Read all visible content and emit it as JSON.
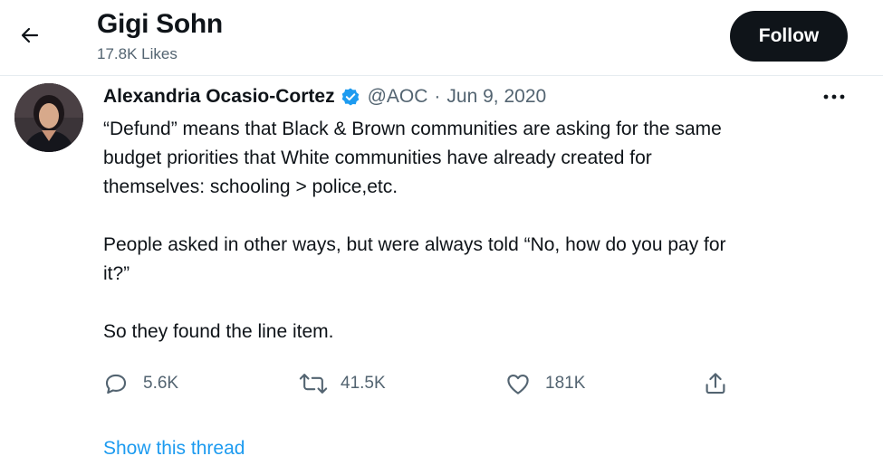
{
  "header": {
    "back_icon": "arrow-left-icon",
    "title": "Gigi Sohn",
    "subtitle": "17.8K Likes",
    "follow_label": "Follow"
  },
  "tweet": {
    "author_name": "Alexandria Ocasio-Cortez",
    "verified_icon": "verified-badge-icon",
    "handle": "@AOC",
    "separator": "·",
    "date": "Jun 9, 2020",
    "more_icon": "more-options-icon",
    "body": {
      "line1": "“Defund” means that Black & Brown communities are asking for the same",
      "line2": "budget priorities that White communities have already created for",
      "line3": "themselves: schooling > police,etc.",
      "line4": "People asked in other ways, but were always told “No, how do you pay for",
      "line5": "it?”",
      "line6": "So they found the line item."
    },
    "actions": {
      "reply": {
        "icon": "reply-icon",
        "count": "5.6K"
      },
      "retweet": {
        "icon": "retweet-icon",
        "count": "41.5K"
      },
      "like": {
        "icon": "heart-icon",
        "count": "181K"
      },
      "share": {
        "icon": "share-icon"
      }
    },
    "show_thread": "Show this thread"
  },
  "colors": {
    "accent": "#1d9bf0",
    "text": "#0f1419",
    "muted": "#536471",
    "follow_bg": "#0f1419"
  }
}
